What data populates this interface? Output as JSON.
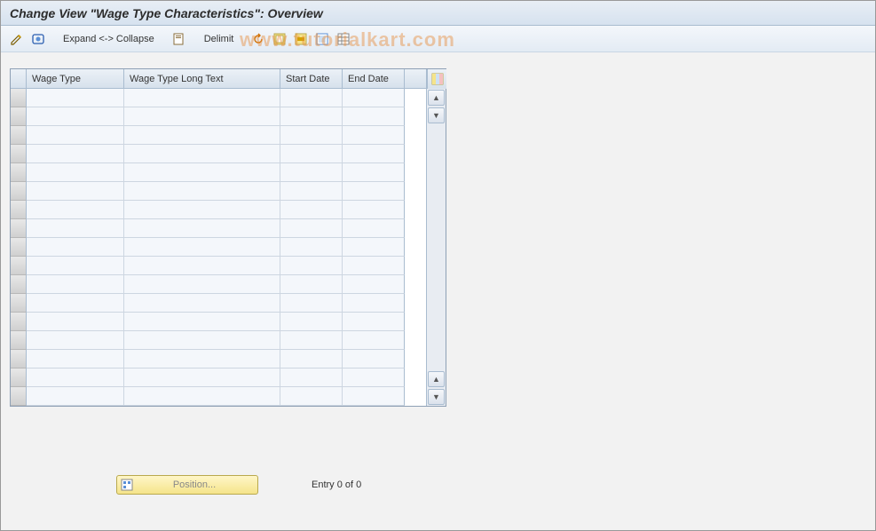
{
  "title": "Change View \"Wage Type Characteristics\": Overview",
  "toolbar": {
    "expand_collapse": "Expand <-> Collapse",
    "delimit": "Delimit"
  },
  "table": {
    "columns": {
      "wage_type": "Wage Type",
      "wage_type_long_text": "Wage Type Long Text",
      "start_date": "Start Date",
      "end_date": "End Date"
    },
    "row_count": 17
  },
  "footer": {
    "position_label": "Position...",
    "entry_text": "Entry 0 of 0"
  },
  "watermark": "www.tutorialkart.com"
}
